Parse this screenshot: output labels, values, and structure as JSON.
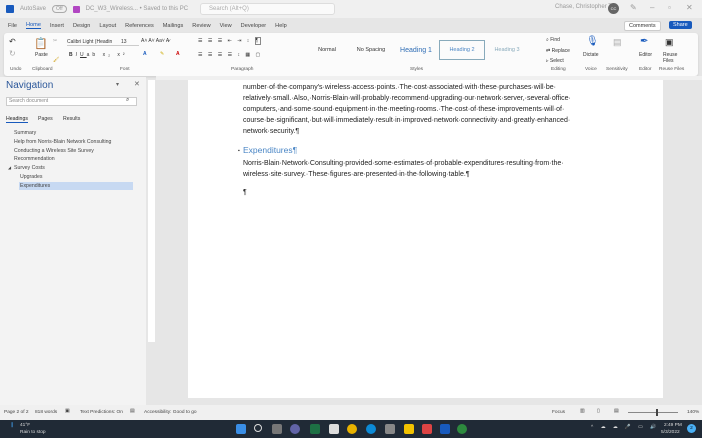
{
  "titlebar": {
    "autosave": "AutoSave",
    "autosave_state": "Off",
    "filename": "DC_W3_Wireless... • Saved to this PC",
    "search_placeholder": "Search (Alt+Q)",
    "user": "Chase, Christopher T",
    "initials": "CC"
  },
  "tabs": [
    "File",
    "Home",
    "Insert",
    "Design",
    "Layout",
    "References",
    "Mailings",
    "Review",
    "View",
    "Developer",
    "Help"
  ],
  "comments": "Comments",
  "share": "Share",
  "ribbon": {
    "groups": [
      "Undo",
      "Clipboard",
      "Font",
      "Paragraph",
      "Styles",
      "Editing",
      "Voice",
      "Sensitivity",
      "Editor",
      "Reuse Files"
    ],
    "paste": "Paste",
    "font_name": "Calibri Light (Headin",
    "font_size": "13",
    "styles": [
      "Normal",
      "No Spacing",
      "Heading 1",
      "Heading 2",
      "Heading 3"
    ],
    "find": "Find",
    "replace": "Replace",
    "select": "Select",
    "dictate": "Dictate",
    "sensitivity": "Sensitivity",
    "editor": "Editor",
    "reuse": "Reuse Files"
  },
  "nav": {
    "title": "Navigation",
    "search_placeholder": "Search document",
    "tabs": [
      "Headings",
      "Pages",
      "Results"
    ],
    "headings": [
      {
        "label": "Summary",
        "level": 1
      },
      {
        "label": "Help from Norris-Blain Network Consulting",
        "level": 1
      },
      {
        "label": "Conducting a Wireless Site Survey",
        "level": 1
      },
      {
        "label": "Recommendation",
        "level": 1
      },
      {
        "label": "Survey Costs",
        "level": 1
      },
      {
        "label": "Upgrades",
        "level": 2
      },
      {
        "label": "Expenditures",
        "level": 2,
        "selected": true
      }
    ]
  },
  "doc": {
    "lines": [
      "number·of·the·company's·wireless·access·points.·The·cost·associated·with·these·purchases·will·be·",
      "relatively·small.·Also,·Norris-Blain·will·probably·recommend·upgrading·our·network·server,·several·office·",
      "computers,·and·some·sound·equipment·in·the·meeting·rooms.·The·cost·of·these·improvements·will·of·",
      "course·be·significant,·but·will·immediately·result·in·improved·network·connectivity·and·greatly·enhanced·",
      "network·security.¶"
    ],
    "heading": "Expenditures¶",
    "para2": [
      "Norris-Blain·Network·Consulting·provided·some·estimates·of·probable·expenditures·resulting·from·the·",
      "wireless·site·survey.·These·figures·are·presented·in·the·following·table.¶"
    ],
    "empty": "¶"
  },
  "status": {
    "page": "Page 2 of 2",
    "words": "818 words",
    "predictions": "Text Predictions: On",
    "accessibility": "Accessibility: Good to go",
    "focus": "Focus",
    "zoom": "140%",
    "zoom_level": 140
  },
  "taskbar": {
    "temp": "41°F",
    "weather": "Rain to stop",
    "time": "2:49 PM",
    "date": "5/3/2022",
    "badge": "2"
  },
  "colors": {
    "accent": "#185abd",
    "heading": "#4a86c5"
  }
}
